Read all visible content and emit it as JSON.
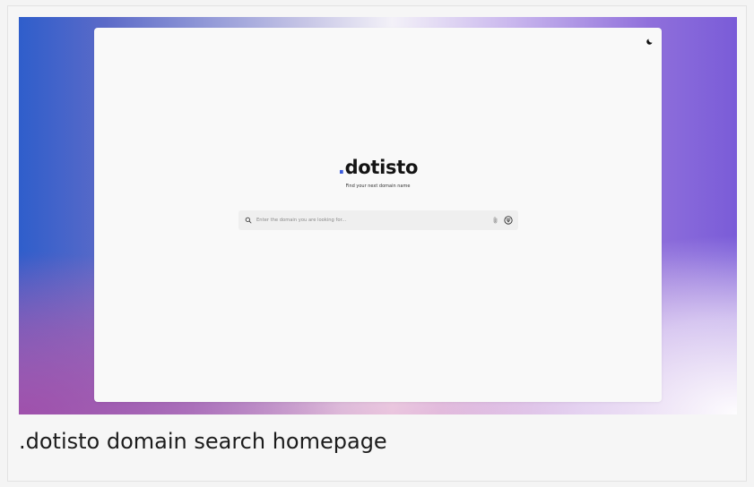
{
  "app": {
    "logo_dot": ".",
    "logo_text": "dotisto",
    "tagline": "Find your next domain name"
  },
  "search": {
    "placeholder": "Enter the domain you are looking for...",
    "value": ""
  },
  "icons": {
    "theme_toggle": "moon-icon",
    "search": "search-icon",
    "attach": "paperclip-icon",
    "filter": "filter-icon"
  },
  "colors": {
    "accent_dot": "#3b5bdb",
    "gradient_left": "#2f5ecb",
    "gradient_right": "#7a5cd8",
    "gradient_bottom_left": "#a04eaa"
  },
  "caption": ".dotisto domain search homepage"
}
